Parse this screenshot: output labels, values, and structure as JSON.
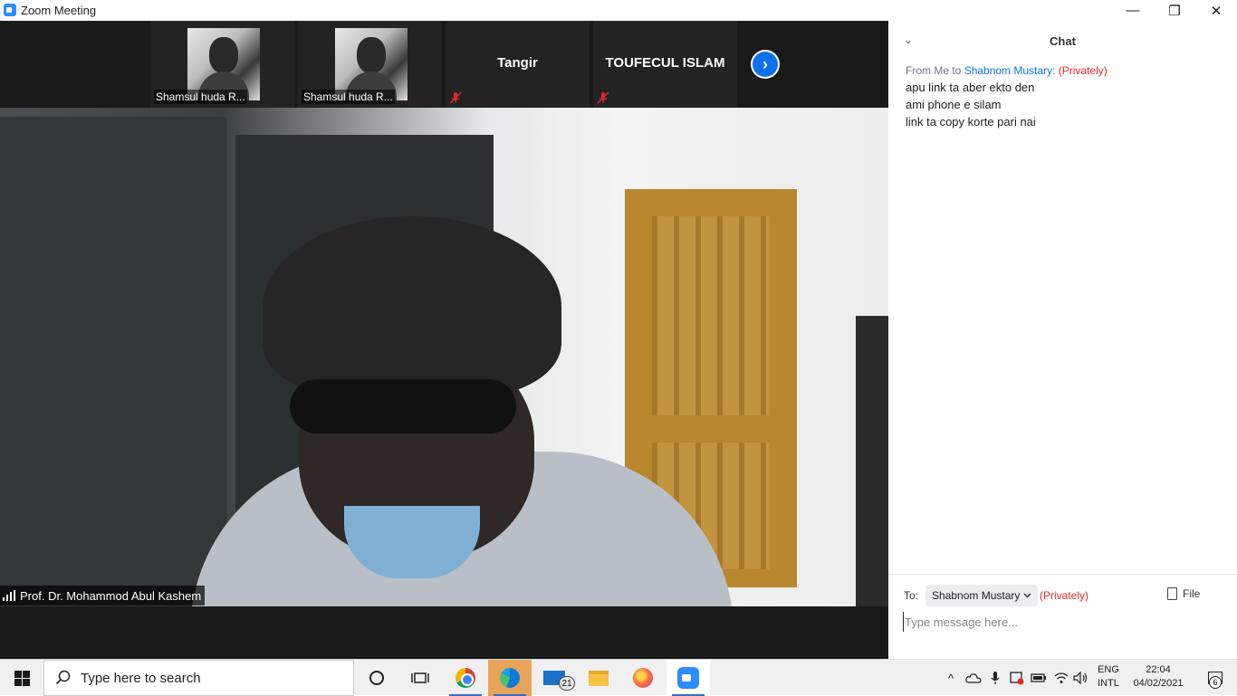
{
  "window": {
    "title": "Zoom Meeting",
    "minimize_glyph": "—",
    "restore_glyph": "❐",
    "close_glyph": "✕"
  },
  "gallery": {
    "tiles": [
      {
        "name": "Shamsul huda R...",
        "has_photo": true
      },
      {
        "name": "Shamsul huda R...",
        "has_photo": true
      },
      {
        "name": "Tangir",
        "muted": true
      },
      {
        "name": "TOUFECUL ISLAM",
        "muted": true
      }
    ],
    "next_icon": "chevron-right-icon"
  },
  "main_video": {
    "speaker_name": "Prof. Dr. Mohammod Abul Kashem",
    "signal_icon": "signal-bars-icon"
  },
  "chat": {
    "title": "Chat",
    "collapse_icon": "chevron-down-icon",
    "message": {
      "from": "From Me to",
      "to": "Shabnom Mustary:",
      "privacy": "(Privately)",
      "lines": [
        "apu link ta aber ekto den",
        "ami phone e silam",
        "link ta copy korte pari nai"
      ]
    },
    "compose": {
      "to_label": "To:",
      "recipient": "Shabnom Mustary",
      "privacy": "(Privately)",
      "file_label": "File",
      "placeholder": "Type message here..."
    }
  },
  "taskbar": {
    "search_placeholder": "Type here to search",
    "mail_badge": "21",
    "tray": {
      "language_line1": "ENG",
      "language_line2": "INTL",
      "time": "22:04",
      "date": "04/02/2021",
      "notification_count": "6"
    }
  },
  "colors": {
    "accent": "#0e71eb",
    "private": "#e02828",
    "zoom_brand": "#2d8cff"
  }
}
